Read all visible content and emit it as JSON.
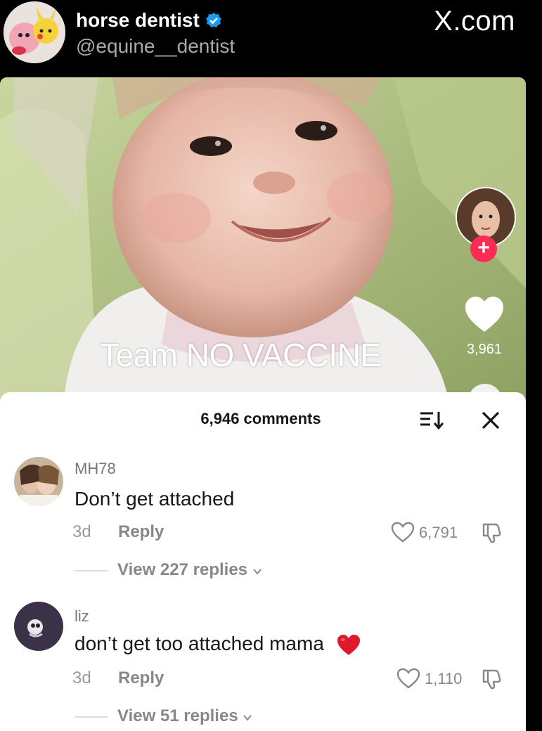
{
  "header": {
    "display_name": "horse dentist",
    "handle": "@equine__dentist",
    "site": "X.com",
    "verified_icon": "verified-badge-icon"
  },
  "video": {
    "overlay_text": "Team NO VACCINE",
    "like_count": "3,961",
    "colors": {
      "background_green": "#9fb07b",
      "follow_red": "#fe2c55"
    }
  },
  "comments_panel": {
    "title": "6,946 comments",
    "comments": [
      {
        "user": "MH78",
        "text": "Don’t get attached",
        "time": "3d",
        "reply_label": "Reply",
        "likes": "6,791",
        "view_replies": "View 227 replies"
      },
      {
        "user": "liz",
        "text": "don’t get too attached mama",
        "time": "3d",
        "reply_label": "Reply",
        "likes": "1,110",
        "view_replies": "View 51 replies"
      }
    ]
  }
}
